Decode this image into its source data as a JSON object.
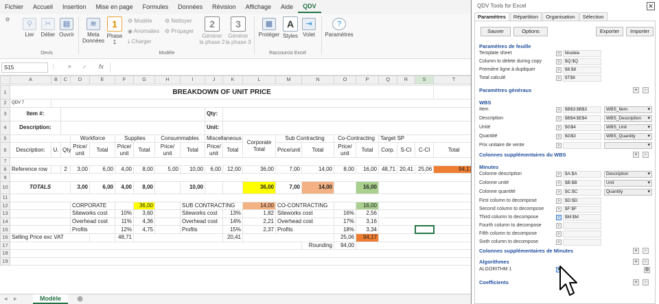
{
  "ribbon": {
    "tabs": [
      "Fichier",
      "Accueil",
      "Insertion",
      "Mise en page",
      "Formules",
      "Données",
      "Révision",
      "Affichage",
      "Aide",
      "QDV"
    ],
    "active_tab": "QDV",
    "buttons": {
      "lier": "Lier",
      "delier": "Délier",
      "ouvrir": "Ouvrir",
      "meta": "Meta",
      "meta2": "Données",
      "phase": "Phase",
      "phase_num": "1",
      "phase_icon": "1",
      "modele": "Modèle",
      "anomalies": "Anomalies",
      "charger": "Charger",
      "nettoyer": "Nettoyer",
      "propager": "Propager",
      "generer2": "Générer",
      "generer2b": "la phase 2",
      "gen2_icon": "2",
      "generer3": "Générer",
      "generer3b": "la phase 3",
      "gen3_icon": "3",
      "proteger": "Protéger",
      "styles": "Styles",
      "volet": "Volet",
      "parametres": "Paramètres"
    },
    "groups": {
      "devis": "Devis",
      "modele": "Modèle",
      "raccourcis": "Raccourcis Excel"
    }
  },
  "formula_bar": {
    "name_box": "S15",
    "fx": "fx"
  },
  "columns": [
    "A",
    "B",
    "C",
    "D",
    "E",
    "F",
    "G",
    "H",
    "I",
    "J",
    "K",
    "L",
    "M",
    "N",
    "O",
    "P",
    "Q",
    "R",
    "S",
    "T"
  ],
  "sheet": {
    "title": "BREAKDOWN OF UNIT PRICE",
    "qdv7": "QDV 7",
    "item_label": "Item #:",
    "qty_label": "Qty:",
    "desc_label": "Description:",
    "unit_label": "Unit:",
    "workforce": "Workforce",
    "supplies": "Supplies",
    "consumables": "Consummables",
    "misc": "Miscellaneous",
    "corporate_total": "Corporate Total",
    "sub_contracting": "Sub Contracting",
    "co_contracting": "Co-Contracting",
    "target_sp": "Target SP",
    "description_h": "Description:",
    "u_h": "U.",
    "qty_h": "Qty",
    "price_unit": "Price/ unit",
    "total": "Total",
    "price_unit2": "Price/unit",
    "corp": "Corp.",
    "s_ci": "S-CI",
    "c_ci": "C-CI",
    "total2": "Total",
    "row8": [
      "Reference row",
      "",
      "2",
      "3,00",
      "6,00",
      "4,00",
      "8,00",
      "5,00",
      "10,00",
      "6,00",
      "12,00",
      "36,00",
      "7,00",
      "14,00",
      "8,00",
      "16,00",
      "48,71",
      "20,41",
      "25,06",
      "94,17"
    ],
    "totals_label": "TOTALS",
    "totals": [
      "3,00",
      "6,00",
      "4,00",
      "8,00",
      "10,00",
      "36,00",
      "7,00",
      "14,00",
      "16,00"
    ],
    "corporate": "CORPORATE",
    "corp_val": "36,00",
    "siteworks": "Siteworks cost",
    "overhead": "Overhead cost",
    "profits": "Profits",
    "corp_pct": [
      "10%",
      "11%",
      "12%"
    ],
    "corp_vals": [
      "3,60",
      "4,36",
      "4,75"
    ],
    "corp_total": "48,71",
    "subc": "SUB CONTRACTING",
    "subc_val": "14,00",
    "subc_pct": [
      "13%",
      "14%",
      "15%"
    ],
    "subc_vals": [
      "1,82",
      "2,21",
      "2,37"
    ],
    "subc_total": "20,41",
    "coc": "CO-CONTRACTING",
    "coc_val": "16,00",
    "coc_pct": [
      "16%",
      "17%",
      "18%"
    ],
    "coc_vals": [
      "2,56",
      "3,16",
      "3,34"
    ],
    "coc_total": "25,06",
    "selling": "Selling Price  exc VAT",
    "selling_val": "94,17",
    "rounding": "Rounding",
    "rounding_val": "94,00"
  },
  "sheet_tab": "Modèle",
  "panel": {
    "title": "QDV Tools for Excel",
    "close": "✕",
    "tabs": [
      "Paramètres",
      "Répartition",
      "Organisation",
      "Sélection"
    ],
    "btn_sauver": "Sauver",
    "btn_options": "Options",
    "btn_exporter": "Exporter",
    "btn_importer": "Importer",
    "sec_feuille": "Paramètres de feuille",
    "template_sheet": "Template sheet",
    "template_val": "Modèle",
    "col_delete": "Column to delete during copy",
    "col_delete_val": "$Q:$Q",
    "premiere": "Première ligne à dupliquer",
    "premiere_val": "$8:$8",
    "total_calc": "Total calculé",
    "total_calc_val": "$T$8",
    "sec_generaux": "Paramètres généraux",
    "wbs": "WBS",
    "item": "Item",
    "item_val": "$B$3:$B$3",
    "item_sel": "WBS_Item",
    "description": "Description",
    "desc_val": "$B$4:$E$4",
    "desc_sel": "WBS_Description",
    "unite": "Unité",
    "unite_val": "$G$4",
    "unite_sel": "WBS_Unit",
    "quantite": "Quantité",
    "quant_val": "$G$3",
    "quant_sel": "WBS_Quantity",
    "prix": "Prix unitaire de vente",
    "sec_cols_wbs": "Colonnes supplémentaires du WBS",
    "minutes": "Minutes",
    "col_desc": "Colonne description",
    "col_desc_val": "$A:$A",
    "col_desc_sel": "Description",
    "col_unite": "Colonne unité",
    "col_unite_val": "$B:$B",
    "col_unite_sel": "Unit",
    "col_quant": "Colonne quantité",
    "col_quant_val": "$C:$C",
    "col_quant_sel": "Quantity",
    "first_dec": "First column to decompose",
    "first_val": "$D:$D",
    "second_dec": "Second column to decompose",
    "second_val": "$F:$F",
    "third_dec": "Third column to decompose",
    "third_val": "$M:$M",
    "fourth_dec": "Fourth column to decompose",
    "fifth_dec": "Fifth column to decompose",
    "sixth_dec": "Sixth column to decompose",
    "sec_cols_min": "Colonnes supplémentaires de Minutes",
    "sec_algo": "Algorithmes",
    "algo_val": "ALGORITHM 1",
    "sec_coef": "Coefficients"
  }
}
